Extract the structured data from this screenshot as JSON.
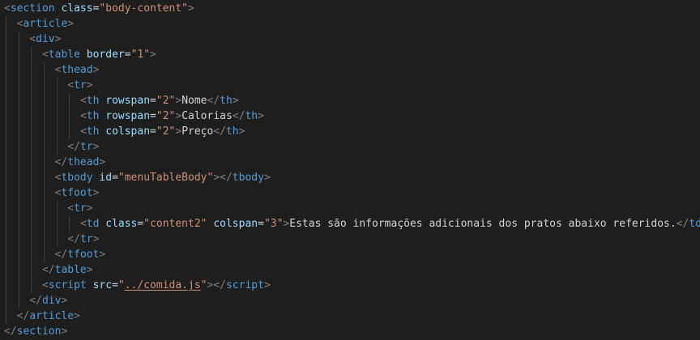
{
  "editor": {
    "lines": [
      {
        "indent": 0,
        "tokens": [
          [
            "p",
            "<"
          ],
          [
            "t",
            "section"
          ],
          [
            "sp",
            " "
          ],
          [
            "a",
            "class"
          ],
          [
            "e",
            "="
          ],
          [
            "s",
            "\"body-content\""
          ],
          [
            "p",
            ">"
          ]
        ]
      },
      {
        "indent": 1,
        "tokens": [
          [
            "p",
            "<"
          ],
          [
            "t",
            "article"
          ],
          [
            "p",
            ">"
          ]
        ]
      },
      {
        "indent": 2,
        "tokens": [
          [
            "p",
            "<"
          ],
          [
            "t",
            "div"
          ],
          [
            "p",
            ">"
          ]
        ]
      },
      {
        "indent": 3,
        "tokens": [
          [
            "p",
            "<"
          ],
          [
            "t",
            "table"
          ],
          [
            "sp",
            " "
          ],
          [
            "a",
            "border"
          ],
          [
            "e",
            "="
          ],
          [
            "s",
            "\"1\""
          ],
          [
            "p",
            ">"
          ]
        ]
      },
      {
        "indent": 4,
        "tokens": [
          [
            "p",
            "<"
          ],
          [
            "t",
            "thead"
          ],
          [
            "p",
            ">"
          ]
        ]
      },
      {
        "indent": 5,
        "tokens": [
          [
            "p",
            "<"
          ],
          [
            "t",
            "tr"
          ],
          [
            "p",
            ">"
          ]
        ]
      },
      {
        "indent": 6,
        "tokens": [
          [
            "p",
            "<"
          ],
          [
            "t",
            "th"
          ],
          [
            "sp",
            " "
          ],
          [
            "a",
            "rowspan"
          ],
          [
            "e",
            "="
          ],
          [
            "s",
            "\"2\""
          ],
          [
            "p",
            ">"
          ],
          [
            "tx",
            "Nome"
          ],
          [
            "p",
            "</"
          ],
          [
            "t",
            "th"
          ],
          [
            "p",
            ">"
          ]
        ]
      },
      {
        "indent": 6,
        "tokens": [
          [
            "p",
            "<"
          ],
          [
            "t",
            "th"
          ],
          [
            "sp",
            " "
          ],
          [
            "a",
            "rowspan"
          ],
          [
            "e",
            "="
          ],
          [
            "s",
            "\"2\""
          ],
          [
            "p",
            ">"
          ],
          [
            "tx",
            "Calorias"
          ],
          [
            "p",
            "</"
          ],
          [
            "t",
            "th"
          ],
          [
            "p",
            ">"
          ]
        ]
      },
      {
        "indent": 6,
        "tokens": [
          [
            "p",
            "<"
          ],
          [
            "t",
            "th"
          ],
          [
            "sp",
            " "
          ],
          [
            "a",
            "colspan"
          ],
          [
            "e",
            "="
          ],
          [
            "s",
            "\"2\""
          ],
          [
            "p",
            ">"
          ],
          [
            "tx",
            "Preço"
          ],
          [
            "p",
            "</"
          ],
          [
            "t",
            "th"
          ],
          [
            "p",
            ">"
          ]
        ]
      },
      {
        "indent": 5,
        "tokens": [
          [
            "p",
            "</"
          ],
          [
            "t",
            "tr"
          ],
          [
            "p",
            ">"
          ]
        ]
      },
      {
        "indent": 4,
        "tokens": [
          [
            "p",
            "</"
          ],
          [
            "t",
            "thead"
          ],
          [
            "p",
            ">"
          ]
        ]
      },
      {
        "indent": 4,
        "tokens": [
          [
            "p",
            "<"
          ],
          [
            "t",
            "tbody"
          ],
          [
            "sp",
            " "
          ],
          [
            "a",
            "id"
          ],
          [
            "e",
            "="
          ],
          [
            "s",
            "\"menuTableBody\""
          ],
          [
            "p",
            "></"
          ],
          [
            "t",
            "tbody"
          ],
          [
            "p",
            ">"
          ]
        ]
      },
      {
        "indent": 4,
        "tokens": [
          [
            "p",
            "<"
          ],
          [
            "t",
            "tfoot"
          ],
          [
            "p",
            ">"
          ]
        ]
      },
      {
        "indent": 5,
        "tokens": [
          [
            "p",
            "<"
          ],
          [
            "t",
            "tr"
          ],
          [
            "p",
            ">"
          ]
        ]
      },
      {
        "indent": 6,
        "tokens": [
          [
            "p",
            "<"
          ],
          [
            "t",
            "td"
          ],
          [
            "sp",
            " "
          ],
          [
            "a",
            "class"
          ],
          [
            "e",
            "="
          ],
          [
            "s",
            "\"content2\""
          ],
          [
            "sp",
            " "
          ],
          [
            "a",
            "colspan"
          ],
          [
            "e",
            "="
          ],
          [
            "s",
            "\"3\""
          ],
          [
            "p",
            ">"
          ],
          [
            "tx",
            "Estas são informações adicionais dos pratos abaixo referidos."
          ],
          [
            "p",
            "</"
          ],
          [
            "t",
            "td"
          ],
          [
            "p",
            ">"
          ]
        ]
      },
      {
        "indent": 5,
        "tokens": [
          [
            "p",
            "</"
          ],
          [
            "t",
            "tr"
          ],
          [
            "p",
            ">"
          ]
        ]
      },
      {
        "indent": 4,
        "tokens": [
          [
            "p",
            "</"
          ],
          [
            "t",
            "tfoot"
          ],
          [
            "p",
            ">"
          ]
        ]
      },
      {
        "indent": 3,
        "tokens": [
          [
            "p",
            "</"
          ],
          [
            "t",
            "table"
          ],
          [
            "p",
            ">"
          ]
        ]
      },
      {
        "indent": 3,
        "tokens": [
          [
            "p",
            "<"
          ],
          [
            "t",
            "script"
          ],
          [
            "sp",
            " "
          ],
          [
            "a",
            "src"
          ],
          [
            "e",
            "="
          ],
          [
            "s",
            "\""
          ],
          [
            "su",
            "../comida.js"
          ],
          [
            "s",
            "\""
          ],
          [
            "p",
            "></"
          ],
          [
            "t",
            "script"
          ],
          [
            "p",
            ">"
          ]
        ]
      },
      {
        "indent": 2,
        "tokens": [
          [
            "p",
            "</"
          ],
          [
            "t",
            "div"
          ],
          [
            "p",
            ">"
          ]
        ]
      },
      {
        "indent": 1,
        "tokens": [
          [
            "p",
            "</"
          ],
          [
            "t",
            "article"
          ],
          [
            "p",
            ">"
          ]
        ]
      },
      {
        "indent": 0,
        "tokens": [
          [
            "p",
            "</"
          ],
          [
            "t",
            "section"
          ],
          [
            "p",
            ">"
          ]
        ]
      }
    ]
  }
}
